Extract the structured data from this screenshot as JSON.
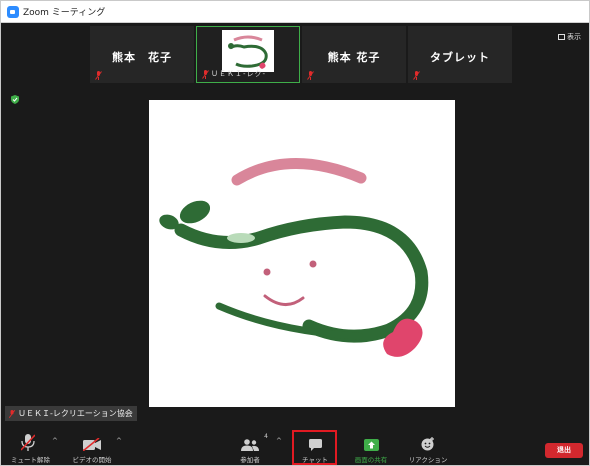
{
  "window": {
    "title": "Zoom ミーティング"
  },
  "strip": {
    "tiles": [
      {
        "name": "熊本　花子"
      },
      {
        "label": "ＵＥＫＩ-レク-"
      },
      {
        "name": "熊本 花子"
      },
      {
        "name": "タブレット"
      }
    ],
    "view_label": "表示"
  },
  "speaker_tag": "ＵＥＫＩ-レクリエーション協会",
  "toolbar": {
    "unmute": "ミュート解除",
    "start_video": "ビデオの開始",
    "participants": "参加者",
    "participants_count": "4",
    "chat": "チャット",
    "share_screen": "画面の共有",
    "reactions": "リアクション",
    "leave": "退出"
  },
  "colors": {
    "accent_green": "#3fae49",
    "leave_red": "#d2282e",
    "highlight_red": "#e11a22",
    "drawing_green": "#2e6b35",
    "drawing_pink": "#d9869a",
    "heart": "#e0456c"
  }
}
